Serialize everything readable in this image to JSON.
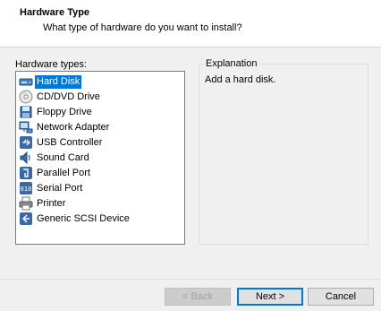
{
  "header": {
    "title": "Hardware Type",
    "subtitle": "What type of hardware do you want to install?"
  },
  "hardware_list": {
    "label": "Hardware types:",
    "selected": "Hard Disk",
    "items": [
      {
        "label": "Hard Disk",
        "icon": "hard-disk-icon"
      },
      {
        "label": "CD/DVD Drive",
        "icon": "cd-dvd-icon"
      },
      {
        "label": "Floppy Drive",
        "icon": "floppy-icon"
      },
      {
        "label": "Network Adapter",
        "icon": "network-adapter-icon"
      },
      {
        "label": "USB Controller",
        "icon": "usb-icon"
      },
      {
        "label": "Sound Card",
        "icon": "sound-card-icon"
      },
      {
        "label": "Parallel Port",
        "icon": "parallel-port-icon"
      },
      {
        "label": "Serial Port",
        "icon": "serial-port-icon"
      },
      {
        "label": "Printer",
        "icon": "printer-icon"
      },
      {
        "label": "Generic SCSI Device",
        "icon": "scsi-icon"
      }
    ]
  },
  "explanation": {
    "title": "Explanation",
    "text": "Add a hard disk."
  },
  "buttons": {
    "back": "< Back",
    "next": "Next >",
    "cancel": "Cancel"
  },
  "colors": {
    "selection": "#0078d7",
    "icon_blue": "#1f5fa8"
  }
}
